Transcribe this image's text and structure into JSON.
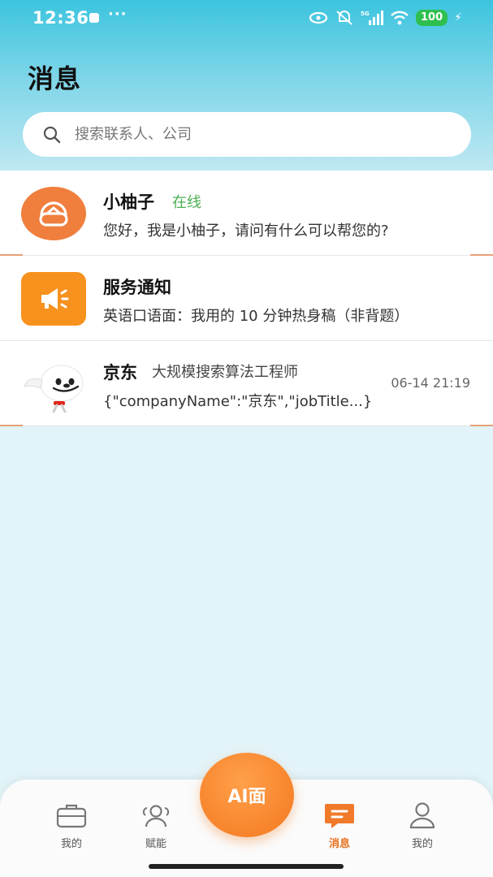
{
  "status_bar": {
    "time": "12:36",
    "dots": "···",
    "battery": "100"
  },
  "header": {
    "title": "消息"
  },
  "search": {
    "placeholder": "搜索联系人、公司"
  },
  "conversations": [
    {
      "name": "小柚子",
      "status": "在线",
      "preview": "您好，我是小柚子，请问有什么可以帮您的?",
      "avatar_icon": "headset-robot-icon",
      "avatar_color": "#f07e3d"
    },
    {
      "name": "服务通知",
      "preview": "英语口语面：我用的 10 分钟热身稿（非背题）",
      "avatar_icon": "megaphone-icon",
      "avatar_color": "#f7921e"
    },
    {
      "name": "京东",
      "subtitle": "大规模搜索算法工程师",
      "preview": "{\"companyName\":\"京东\",\"jobTitle...}",
      "timestamp": "06-14 21:19",
      "avatar_icon": "jd-dog-mascot-icon"
    }
  ],
  "tabbar": {
    "tabs": [
      {
        "label": "我的",
        "icon": "briefcase-icon",
        "active": false
      },
      {
        "label": "赋能",
        "icon": "people-icon",
        "active": false
      },
      {
        "label": "消息",
        "icon": "chat-icon",
        "active": true
      },
      {
        "label": "我的",
        "icon": "person-icon",
        "active": false
      }
    ],
    "center_button": "AI面",
    "active_color": "#e8711f",
    "accent_color": "#f4781f"
  }
}
